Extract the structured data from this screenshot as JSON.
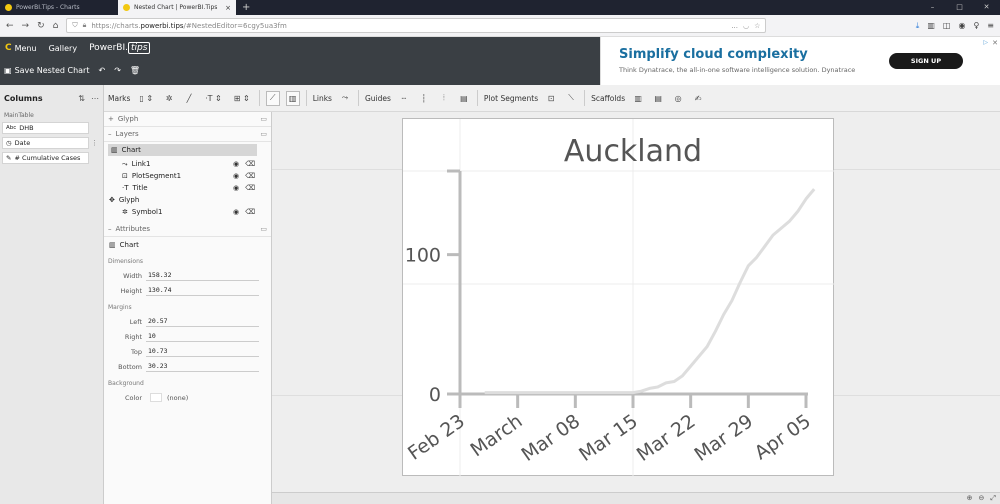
{
  "browser": {
    "tabs": [
      {
        "label": "PowerBI.Tips - Charts",
        "active": false
      },
      {
        "label": "Nested Chart | PowerBI.Tips",
        "active": true
      }
    ],
    "url_prefix": "https://charts.",
    "url_host": "powerbi.tips",
    "url_path": "/#NestedEditor=6cgy5ua3fm",
    "more_icon": "..."
  },
  "app": {
    "menu_label": "Menu",
    "gallery_label": "Gallery",
    "brand": "PowerBI.",
    "brand_tips": "tips",
    "save_label": "Save Nested Chart"
  },
  "ad": {
    "headline": "Simplify cloud complexity",
    "sub": "Think Dynatrace, the all-in-one software intelligence solution. Dynatrace",
    "cta": "SIGN UP"
  },
  "toolbar": {
    "marks": "Marks",
    "links": "Links",
    "guides": "Guides",
    "plot_segments": "Plot Segments",
    "scaffolds": "Scaffolds"
  },
  "columns": {
    "title": "Columns",
    "table": "MainTable",
    "items": [
      {
        "label": "DHB",
        "icon": "abc"
      },
      {
        "label": "Date",
        "icon": "clock"
      },
      {
        "label": "# Cumulative Cases",
        "icon": "pencil"
      }
    ]
  },
  "layers": {
    "glyph_section": "Glyph",
    "layers_section": "Layers",
    "chart": "Chart",
    "children": [
      "Link1",
      "PlotSegment1",
      "Title"
    ],
    "glyph": "Glyph",
    "symbol": "Symbol1",
    "attributes_section": "Attributes",
    "attr_chart": "Chart",
    "dimensions": "Dimensions",
    "width_label": "Width",
    "width": "158.32",
    "height_label": "Height",
    "height": "130.74",
    "margins": "Margins",
    "left_label": "Left",
    "left": "20.57",
    "right_label": "Right",
    "right": "10",
    "top_label": "Top",
    "top": "10.73",
    "bottom_label": "Bottom",
    "bottom": "30.23",
    "background": "Background",
    "color_label": "Color",
    "color": "(none)"
  },
  "chart_data": {
    "type": "line",
    "title": "Auckland",
    "x_ticks": [
      "Feb 23",
      "March",
      "Mar 08",
      "Mar 15",
      "Mar 22",
      "Mar 29",
      "Apr 05"
    ],
    "y_ticks": [
      "0",
      "100"
    ],
    "ylim": [
      0,
      160
    ],
    "series": [
      {
        "x": [
          "Feb 26",
          "Feb 28",
          "Mar 02",
          "Mar 04",
          "Mar 06",
          "Mar 08",
          "Mar 10",
          "Mar 12",
          "Mar 14",
          "Mar 15",
          "Mar 16",
          "Mar 17",
          "Mar 18",
          "Mar 19",
          "Mar 20",
          "Mar 21",
          "Mar 22",
          "Mar 23",
          "Mar 24",
          "Mar 25",
          "Mar 26",
          "Mar 27",
          "Mar 28",
          "Mar 29",
          "Mar 30",
          "Mar 31",
          "Apr 01",
          "Apr 02",
          "Apr 03",
          "Apr 04",
          "Apr 05",
          "Apr 06"
        ],
        "values": [
          1,
          1,
          1,
          1,
          1,
          1,
          1,
          1,
          1,
          1,
          2,
          4,
          5,
          8,
          9,
          13,
          20,
          27,
          34,
          45,
          57,
          67,
          80,
          92,
          98,
          106,
          114,
          119,
          124,
          131,
          140,
          147
        ]
      }
    ],
    "line_color": "#dddddd"
  }
}
